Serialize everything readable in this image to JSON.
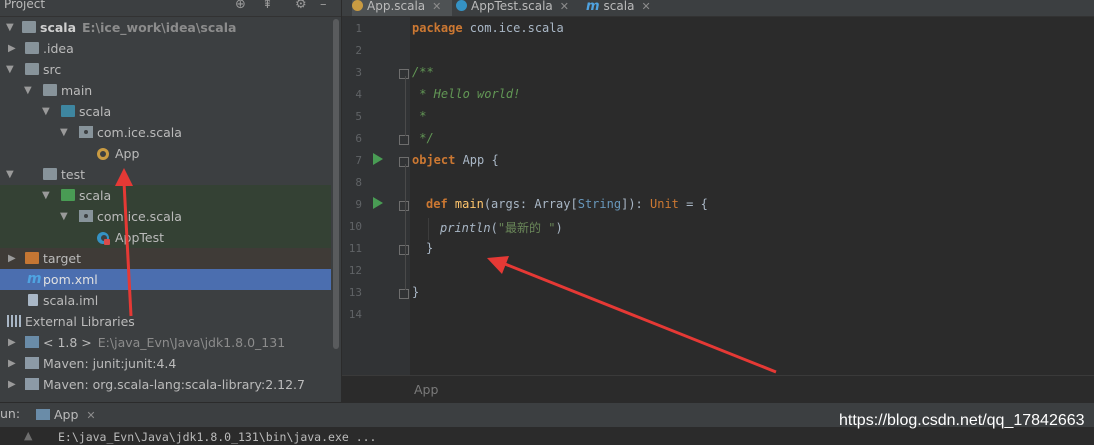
{
  "project_panel": {
    "title": "Project",
    "tree": [
      {
        "label": "scala",
        "path": "E:\\ice_work\\idea\\scala",
        "icon": "module-folder-icon",
        "bold": true
      },
      {
        "label": ".idea",
        "icon": "folder-icon"
      },
      {
        "label": "src",
        "icon": "folder-icon"
      },
      {
        "label": "main",
        "icon": "folder-icon"
      },
      {
        "label": "scala",
        "icon": "source-folder-icon"
      },
      {
        "label": "com.ice.scala",
        "icon": "package-icon"
      },
      {
        "label": "App",
        "icon": "scala-object-icon"
      },
      {
        "label": "test",
        "icon": "folder-icon"
      },
      {
        "label": "scala",
        "icon": "test-source-folder-icon"
      },
      {
        "label": "com.ice.scala",
        "icon": "package-icon"
      },
      {
        "label": "AppTest",
        "icon": "scala-class-icon"
      },
      {
        "label": "target",
        "icon": "excluded-folder-icon"
      },
      {
        "label": "pom.xml",
        "icon": "maven-icon"
      },
      {
        "label": "scala.iml",
        "icon": "file-icon"
      },
      {
        "label": "External Libraries",
        "icon": "libraries-icon"
      },
      {
        "label": "< 1.8 >",
        "path": "E:\\java_Evn\\Java\\jdk1.8.0_131",
        "icon": "jdk-icon"
      },
      {
        "label": "Maven: junit:junit:4.4",
        "icon": "maven-library-icon"
      },
      {
        "label": "Maven: org.scala-lang:scala-library:2.12.7",
        "icon": "maven-library-icon"
      }
    ]
  },
  "editor": {
    "tabs": [
      {
        "label": "App.scala",
        "icon": "scala-object-icon"
      },
      {
        "label": "AppTest.scala",
        "icon": "scala-class-icon"
      },
      {
        "label": "scala",
        "icon": "maven-icon"
      }
    ],
    "line_numbers": [
      "1",
      "2",
      "3",
      "4",
      "5",
      "6",
      "7",
      "8",
      "9",
      "10",
      "11",
      "12",
      "13",
      "14"
    ],
    "code": {
      "l1_kw": "package",
      "l1_rest": " com.ice.scala",
      "l3": "/**",
      "l4": " * Hello world!",
      "l5": " *",
      "l6": " */",
      "l7_kw": "object",
      "l7_rest": " App {",
      "l9_kw": "def",
      "l9_name": " main",
      "l9_a": "(args: Array[",
      "l9_type": "String",
      "l9_b": "]): ",
      "l9_unit": "Unit",
      "l9_c": " = {",
      "l10_fn": "println",
      "l10_a": "(",
      "l10_str": "\"最新的 \"",
      "l10_b": ")",
      "l11": "}",
      "l13": "}"
    },
    "breadcrumb": "App"
  },
  "run_panel": {
    "label": "un:",
    "tab": "App",
    "console_output": "E:\\java_Evn\\Java\\jdk1.8.0_131\\bin\\java.exe ..."
  },
  "watermark": "https://blog.csdn.net/qq_17842663",
  "colors": {
    "annotation_arrow": "#e53935",
    "selection": "#4b6eaf"
  }
}
